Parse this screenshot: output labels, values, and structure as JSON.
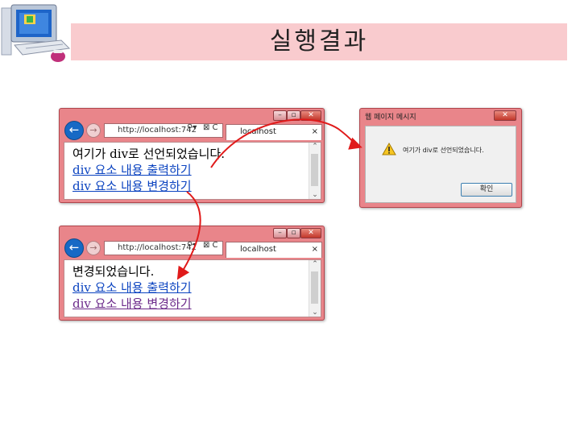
{
  "slide": {
    "title": "실행결과"
  },
  "colors": {
    "title_bar": "#f9cbce",
    "window_frame": "#e9858a",
    "arrow": "#e01a1a",
    "link": "#0b43c0"
  },
  "browser_top": {
    "address": "http://localhost:742",
    "tab_label": "localhost",
    "lines": [
      "여기가 div로 선언되었습니다."
    ],
    "link_output": "div 요소 내용 출력하기",
    "link_change": "div 요소 내용 변경하기"
  },
  "browser_bottom": {
    "address": "http://localhost:742",
    "tab_label": "localhost",
    "lines": [
      "변경되었습니다."
    ],
    "link_output": "div 요소 내용 출력하기",
    "link_change": "div 요소 내용 변경하기"
  },
  "dialog": {
    "title": "웹 페이지 메시지",
    "message": "여기가 div로 선언되었습니다.",
    "ok_label": "확인",
    "icon": "warning-icon"
  },
  "icons": {
    "back": "back-arrow-icon",
    "forward": "forward-arrow-icon",
    "search": "search-icon",
    "refresh": "refresh-icon"
  }
}
